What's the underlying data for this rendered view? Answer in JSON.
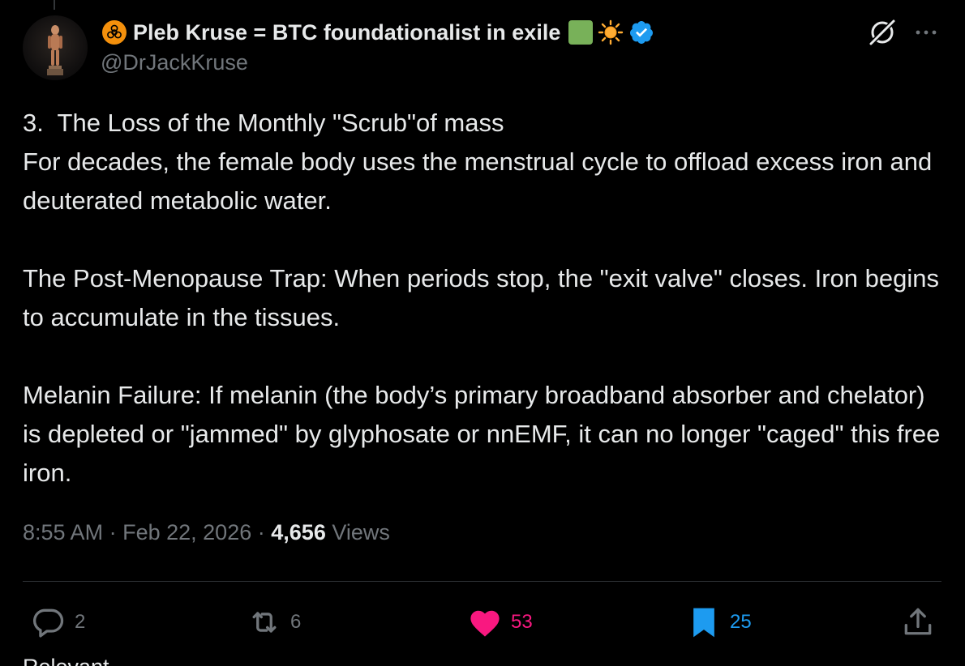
{
  "author": {
    "display_name": "Pleb Kruse = BTC foundationalist in exile",
    "handle": "@DrJackKruse",
    "verified": true,
    "name_emojis": [
      "biohazard",
      "green-square",
      "sun"
    ]
  },
  "post": {
    "paragraphs": [
      "3.  The Loss of the Monthly \"Scrub\"of mass\nFor decades, the female body uses the menstrual cycle to offload excess iron and deuterated metabolic water.",
      "The Post-Menopause Trap: When periods stop, the \"exit valve\" closes. Iron begins to accumulate in the tissues.",
      "Melanin Failure: If melanin (the body’s primary broadband absorber and chelator) is depleted or \"jammed\" by glyphosate or nnEMF, it can no longer \"caged\" this free iron."
    ],
    "time": "8:55 AM",
    "date": "Feb 22, 2026",
    "views_count": "4,656",
    "views_label": "Views",
    "separator": "·"
  },
  "actions": {
    "replies": "2",
    "reposts": "6",
    "likes": "53",
    "bookmarks": "25"
  },
  "colors": {
    "background": "#000000",
    "text": "#e7e9ea",
    "muted": "#71767b",
    "like_active": "#f91880",
    "bookmark_active": "#1d9bf0",
    "verified": "#1d9bf0",
    "divider": "#2f3336"
  },
  "icons": {
    "top_right": [
      "grok-icon",
      "more-icon"
    ],
    "actions": [
      "reply-icon",
      "repost-icon",
      "like-icon",
      "bookmark-icon",
      "share-icon"
    ]
  },
  "bottom_partial_text": "Relevant"
}
